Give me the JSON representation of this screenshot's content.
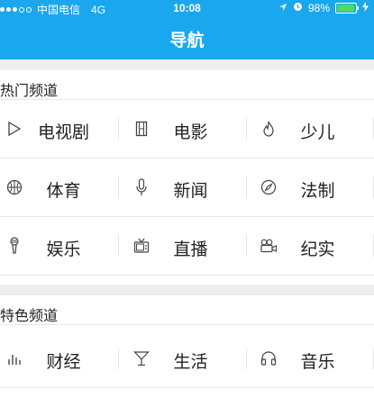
{
  "status_bar": {
    "carrier": "中国电信",
    "network": "4G",
    "time": "10:08",
    "battery": "98%",
    "battery_level": 0.98
  },
  "nav": {
    "title": "导航"
  },
  "sections": [
    {
      "title": "热门频道",
      "rows": [
        [
          {
            "label": "电视剧",
            "icon": "play-icon"
          },
          {
            "label": "电影",
            "icon": "film-icon"
          },
          {
            "label": "少儿",
            "icon": "flame-icon"
          }
        ],
        [
          {
            "label": "体育",
            "icon": "ball-icon"
          },
          {
            "label": "新闻",
            "icon": "microphone-icon"
          },
          {
            "label": "法制",
            "icon": "compass-icon"
          }
        ],
        [
          {
            "label": "娱乐",
            "icon": "mic-stand-icon"
          },
          {
            "label": "直播",
            "icon": "tv-icon"
          },
          {
            "label": "纪实",
            "icon": "camera-icon"
          }
        ]
      ]
    },
    {
      "title": "特色频道",
      "rows": [
        [
          {
            "label": "财经",
            "icon": "bar-chart-icon"
          },
          {
            "label": "生活",
            "icon": "cocktail-icon"
          },
          {
            "label": "音乐",
            "icon": "headphones-icon"
          }
        ]
      ]
    }
  ]
}
